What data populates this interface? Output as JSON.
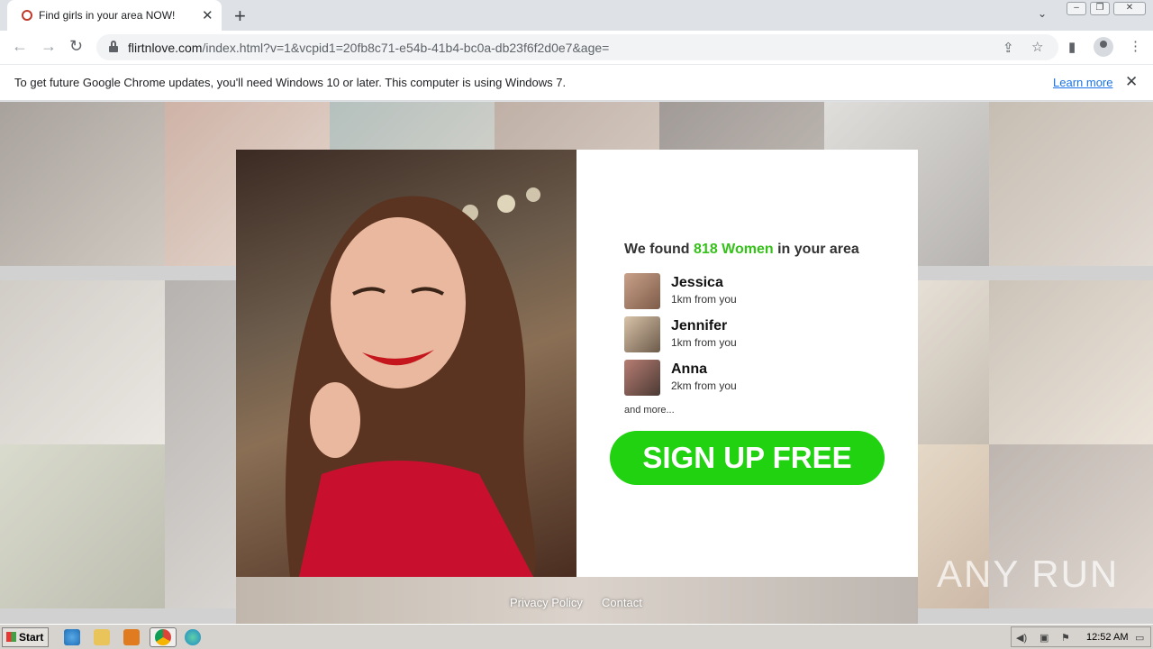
{
  "browser": {
    "tab_title": "Find girls in your area NOW!",
    "url_host": "flirtnlove.com",
    "url_rest": "/index.html?v=1&vcpid1=20fb8c71-e54b-41b4-bc0a-db23f6f2d0e7&age=",
    "infobar_message": "To get future Google Chrome updates, you'll need Windows 10 or later. This computer is using Windows 7.",
    "infobar_link": "Learn more"
  },
  "page": {
    "found_prefix": "We found",
    "found_count": "818 Women",
    "found_suffix": "in your area",
    "profiles": [
      {
        "name": "Jessica",
        "distance": "1km from you"
      },
      {
        "name": "Jennifer",
        "distance": "1km from you"
      },
      {
        "name": "Anna",
        "distance": "2km from you"
      }
    ],
    "and_more": "and more...",
    "signup_label": "SIGN UP FREE",
    "footer": {
      "privacy": "Privacy Policy",
      "contact": "Contact"
    },
    "watermark": "ANY RUN"
  },
  "taskbar": {
    "start_label": "Start",
    "clock": "12:52 AM"
  },
  "colors": {
    "accent_green": "#35c11a",
    "button_green": "#20d20f"
  }
}
